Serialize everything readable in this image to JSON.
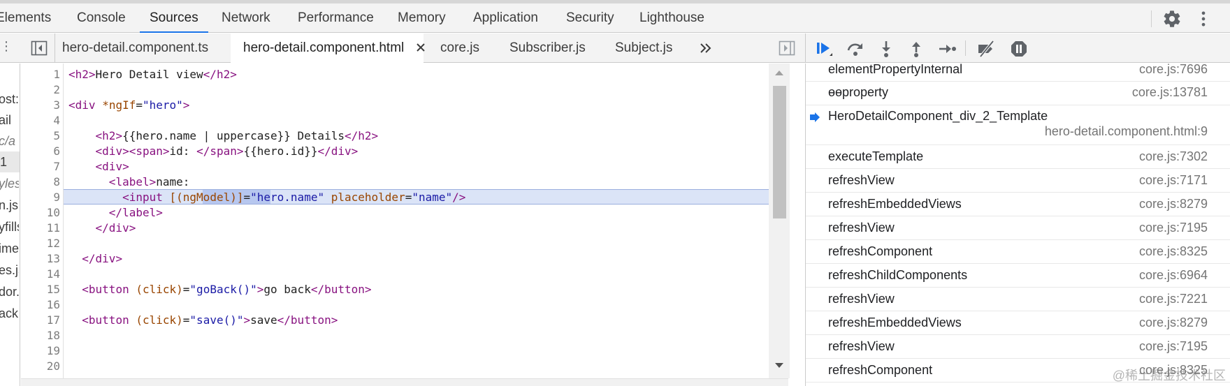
{
  "main_tabs": [
    "Elements",
    "Console",
    "Sources",
    "Network",
    "Performance",
    "Memory",
    "Application",
    "Security",
    "Lighthouse"
  ],
  "active_main_tab": "Sources",
  "source_tabs": [
    "hero-detail.component.ts",
    "hero-detail.component.html",
    "core.js",
    "Subscriber.js",
    "Subject.js"
  ],
  "active_source_tab": "hero-detail.component.html",
  "left_navigator": [
    "ost:",
    "ail",
    "c/a",
    "1",
    "yles",
    "n.js",
    "yfills",
    "ime",
    "es.js",
    "dor.",
    "ack:/"
  ],
  "line_numbers": [
    "1",
    "2",
    "3",
    "4",
    "5",
    "6",
    "7",
    "8",
    "9",
    "10",
    "11",
    "12",
    "13",
    "14",
    "15",
    "16",
    "17",
    "18",
    "19",
    "20"
  ],
  "code": {
    "l1": {
      "o": "<",
      "tag": "h2",
      "c": ">",
      "txt": "Hero Detail view",
      "o2": "</",
      "tag2": "h2",
      "c2": ">"
    },
    "l3": {
      "o": "<",
      "tag": "div",
      "sp": " ",
      "attr": "*ngIf",
      "eq": "=",
      "val": "\"hero\"",
      "c": ">"
    },
    "l5": {
      "indent": "    ",
      "o": "<",
      "tag": "h2",
      "c": ">",
      "txt": "{{hero.name | uppercase}} Details",
      "o2": "</",
      "tag2": "h2",
      "c2": ">"
    },
    "l6": {
      "indent": "    ",
      "o": "<",
      "tag": "div",
      "c": ">",
      "o2": "<",
      "tag2": "span",
      "c2": ">",
      "txt": "id: ",
      "o3": "</",
      "tag3": "span",
      "c3": ">",
      "txt2": "{{hero.id}}",
      "o4": "</",
      "tag4": "div",
      "c4": ">"
    },
    "l7": {
      "indent": "    ",
      "o": "<",
      "tag": "div",
      "c": ">"
    },
    "l8": {
      "indent": "      ",
      "o": "<",
      "tag": "label",
      "c": ">",
      "txt": "name:"
    },
    "l9": {
      "indent": "        ",
      "o": "<",
      "tag": "input",
      "sp": " ",
      "attr": "[(ngModel)]",
      "eq": "=",
      "val": "\"hero.name\"",
      "sp2": " ",
      "attr2": "placeholder",
      "eq2": "=",
      "val2": "\"name\"",
      "c": "/>"
    },
    "l10": {
      "indent": "      ",
      "o": "</",
      "tag": "label",
      "c": ">"
    },
    "l11": {
      "indent": "    ",
      "o": "</",
      "tag": "div",
      "c": ">"
    },
    "l13": {
      "indent": "  ",
      "o": "</",
      "tag": "div",
      "c": ">"
    },
    "l15": {
      "indent": "  ",
      "o": "<",
      "tag": "button",
      "sp": " ",
      "attr": "(click)",
      "eq": "=",
      "val": "\"goBack()\"",
      "c": ">",
      "txt": "go back",
      "o2": "</",
      "tag2": "button",
      "c2": ">"
    },
    "l17": {
      "indent": "  ",
      "o": "<",
      "tag": "button",
      "sp": " ",
      "attr": "(click)",
      "eq": "=",
      "val": "\"save()\"",
      "c": ">",
      "txt": "save",
      "o2": "</",
      "tag2": "button",
      "c2": ">"
    }
  },
  "call_stack": [
    {
      "name": "elementPropertyInternal",
      "location": "core.js:7696"
    },
    {
      "name": "ɵɵproperty",
      "location": "core.js:13781"
    },
    {
      "name": "HeroDetailComponent_div_2_Template",
      "location": "hero-detail.component.html:9",
      "current": true
    },
    {
      "name": "executeTemplate",
      "location": "core.js:7302"
    },
    {
      "name": "refreshView",
      "location": "core.js:7171"
    },
    {
      "name": "refreshEmbeddedViews",
      "location": "core.js:8279"
    },
    {
      "name": "refreshView",
      "location": "core.js:7195"
    },
    {
      "name": "refreshComponent",
      "location": "core.js:8325"
    },
    {
      "name": "refreshChildComponents",
      "location": "core.js:6964"
    },
    {
      "name": "refreshView",
      "location": "core.js:7221"
    },
    {
      "name": "refreshEmbeddedViews",
      "location": "core.js:8279"
    },
    {
      "name": "refreshView",
      "location": "core.js:7195"
    },
    {
      "name": "refreshComponent",
      "location": "core.js:8325"
    }
  ],
  "watermark": "@稀土掘金技术社区",
  "icons": [
    "gear-icon",
    "more-vert-icon",
    "navigator-toggle-icon",
    "close-icon",
    "chevron-double-right-icon",
    "debugger-toggle-icon",
    "resume-icon",
    "step-over-icon",
    "step-into-icon",
    "step-out-icon",
    "step-icon",
    "deactivate-breakpoints-icon",
    "pause-on-exceptions-icon",
    "current-frame-arrow-icon"
  ],
  "colors": {
    "accent": "#1a73e8",
    "tag": "#881280",
    "attribute": "#994500",
    "value": "#1a1aa6",
    "execution_line": "#dbe4f7",
    "selection": "#b7c7ef"
  }
}
